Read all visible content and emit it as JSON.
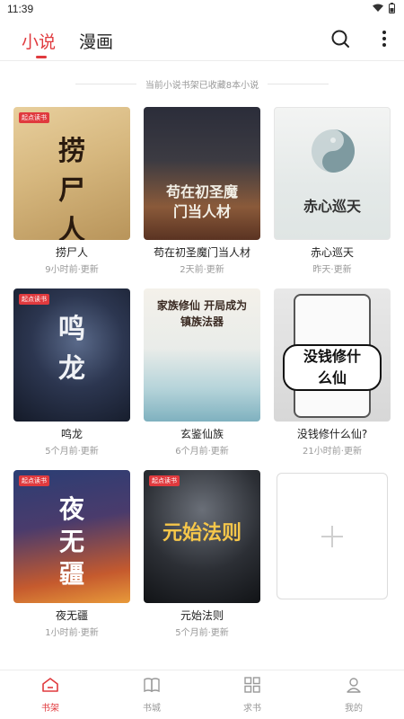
{
  "status_bar": {
    "time": "11:39"
  },
  "tabs": [
    {
      "label": "小说",
      "active": true
    },
    {
      "label": "漫画",
      "active": false
    }
  ],
  "shelf_hint": "当前小说书架已收藏8本小说",
  "books": [
    {
      "title": "捞尸人",
      "updated": "9小时前·更新",
      "cover_text": "捞尸人"
    },
    {
      "title": "苟在初圣魔门当人材",
      "updated": "2天前·更新",
      "cover_text": "苟在初圣魔门当人材"
    },
    {
      "title": "赤心巡天",
      "updated": "昨天·更新",
      "cover_text": "赤心巡天"
    },
    {
      "title": "鸣龙",
      "updated": "5个月前·更新",
      "cover_text": "鸣龙"
    },
    {
      "title": "玄鉴仙族",
      "updated": "6个月前·更新",
      "cover_text": "家族修仙 开局成为镇族法器"
    },
    {
      "title": "没钱修什么仙?",
      "updated": "21小时前·更新",
      "cover_text": "没钱修什么仙"
    },
    {
      "title": "夜无疆",
      "updated": "1小时前·更新",
      "cover_text": "夜无疆"
    },
    {
      "title": "元始法则",
      "updated": "5个月前·更新",
      "cover_text": "元始法则"
    }
  ],
  "cover_badge": "起点读书",
  "bottom_nav": [
    {
      "label": "书架",
      "icon": "bookshelf-icon",
      "active": true
    },
    {
      "label": "书城",
      "icon": "book-city-icon",
      "active": false
    },
    {
      "label": "求书",
      "icon": "request-book-icon",
      "active": false
    },
    {
      "label": "我的",
      "icon": "profile-icon",
      "active": false
    }
  ],
  "colors": {
    "accent": "#e03a3e",
    "muted": "#999999",
    "text": "#222222"
  }
}
